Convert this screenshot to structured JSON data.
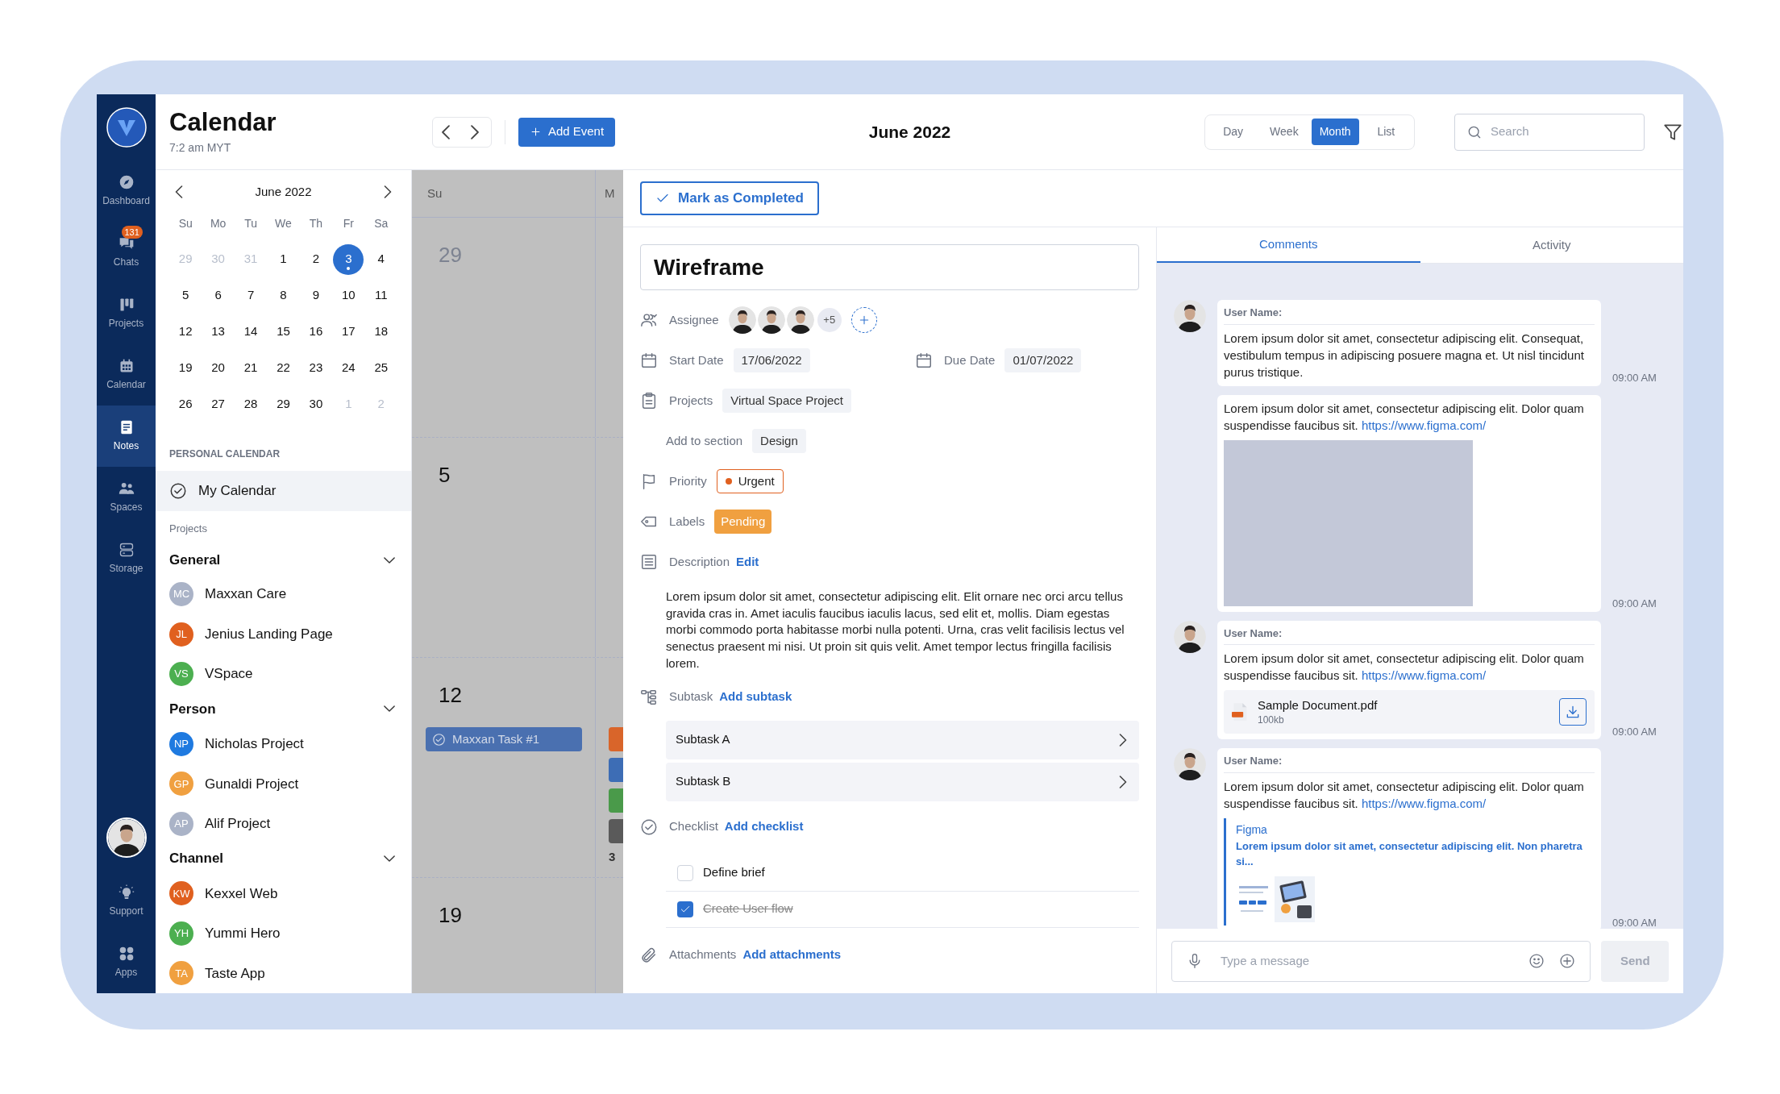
{
  "nav": {
    "items": [
      {
        "label": "Dashboard",
        "selected": false
      },
      {
        "label": "Chats",
        "badge": "131",
        "selected": false
      },
      {
        "label": "Projects",
        "selected": false
      },
      {
        "label": "Calendar",
        "selected": false
      },
      {
        "label": "Notes",
        "selected": true
      },
      {
        "label": "Spaces",
        "selected": false
      },
      {
        "label": "Storage",
        "selected": false
      }
    ],
    "bottom_items": [
      {
        "label": "Support",
        "selected": false
      },
      {
        "label": "Apps",
        "selected": false
      }
    ]
  },
  "header": {
    "title": "Calendar",
    "time": "7:2 am MYT",
    "add_event": "Add Event",
    "period": "June 2022",
    "views": [
      {
        "label": "Day",
        "selected": false
      },
      {
        "label": "Week",
        "selected": false
      },
      {
        "label": "Month",
        "selected": true
      },
      {
        "label": "List",
        "selected": false
      }
    ],
    "search": {
      "placeholder": "Search"
    }
  },
  "mini_calendar": {
    "month": "June 2022",
    "weekdays": [
      "Su",
      "Mo",
      "Tu",
      "We",
      "Th",
      "Fr",
      "Sa"
    ],
    "weeks": [
      [
        {
          "day": "29",
          "outside": true,
          "selected": false
        },
        {
          "day": "30",
          "outside": true,
          "selected": false
        },
        {
          "day": "31",
          "outside": true,
          "selected": false
        },
        {
          "day": "1",
          "outside": false,
          "selected": false
        },
        {
          "day": "2",
          "outside": false,
          "selected": false
        },
        {
          "day": "3",
          "outside": false,
          "selected": true
        },
        {
          "day": "4",
          "outside": false,
          "selected": false
        }
      ],
      [
        {
          "day": "5",
          "outside": false,
          "selected": false
        },
        {
          "day": "6",
          "outside": false,
          "selected": false
        },
        {
          "day": "7",
          "outside": false,
          "selected": false
        },
        {
          "day": "8",
          "outside": false,
          "selected": false
        },
        {
          "day": "9",
          "outside": false,
          "selected": false
        },
        {
          "day": "10",
          "outside": false,
          "selected": false
        },
        {
          "day": "11",
          "outside": false,
          "selected": false
        }
      ],
      [
        {
          "day": "12",
          "outside": false,
          "selected": false
        },
        {
          "day": "13",
          "outside": false,
          "selected": false
        },
        {
          "day": "14",
          "outside": false,
          "selected": false
        },
        {
          "day": "15",
          "outside": false,
          "selected": false
        },
        {
          "day": "16",
          "outside": false,
          "selected": false
        },
        {
          "day": "17",
          "outside": false,
          "selected": false
        },
        {
          "day": "18",
          "outside": false,
          "selected": false
        }
      ],
      [
        {
          "day": "19",
          "outside": false,
          "selected": false
        },
        {
          "day": "20",
          "outside": false,
          "selected": false
        },
        {
          "day": "21",
          "outside": false,
          "selected": false
        },
        {
          "day": "22",
          "outside": false,
          "selected": false
        },
        {
          "day": "23",
          "outside": false,
          "selected": false
        },
        {
          "day": "24",
          "outside": false,
          "selected": false
        },
        {
          "day": "25",
          "outside": false,
          "selected": false
        }
      ],
      [
        {
          "day": "26",
          "outside": false,
          "selected": false
        },
        {
          "day": "27",
          "outside": false,
          "selected": false
        },
        {
          "day": "28",
          "outside": false,
          "selected": false
        },
        {
          "day": "29",
          "outside": false,
          "selected": false
        },
        {
          "day": "30",
          "outside": false,
          "selected": false
        },
        {
          "day": "1",
          "outside": true,
          "selected": false
        },
        {
          "day": "2",
          "outside": true,
          "selected": false
        }
      ]
    ]
  },
  "personal_calendar": {
    "heading": "PERSONAL CALENDAR",
    "items": [
      {
        "label": "My Calendar",
        "selected": true
      }
    ]
  },
  "projects": {
    "heading": "Projects",
    "groups": [
      {
        "name": "General",
        "expanded": true,
        "items": [
          {
            "initials": "MC",
            "name": "Maxxan Care",
            "color": "#aab3c7"
          },
          {
            "initials": "JL",
            "name": "Jenius Landing Page",
            "color": "#e0601f"
          },
          {
            "initials": "VS",
            "name": "VSpace",
            "color": "#4caf50"
          }
        ]
      },
      {
        "name": "Person",
        "expanded": true,
        "items": [
          {
            "initials": "NP",
            "name": "Nicholas Project",
            "color": "#1f7ae0"
          },
          {
            "initials": "GP",
            "name": "Gunaldi Project",
            "color": "#f0a040"
          },
          {
            "initials": "AP",
            "name": "Alif Project",
            "color": "#aab3c7"
          }
        ]
      },
      {
        "name": "Channel",
        "expanded": true,
        "items": [
          {
            "initials": "KW",
            "name": "Kexxel Web",
            "color": "#e0601f"
          },
          {
            "initials": "YH",
            "name": "Yummi Hero",
            "color": "#4caf50"
          },
          {
            "initials": "TA",
            "name": "Taste App",
            "color": "#f0a040"
          }
        ]
      }
    ]
  },
  "month_grid": {
    "columns": [
      {
        "weekday": "Su",
        "cells": [
          {
            "day": "29",
            "outside": true
          },
          {
            "day": "5",
            "outside": false
          },
          {
            "day": "12",
            "outside": false,
            "events": [
              {
                "title": "Maxxan Task #1"
              }
            ]
          },
          {
            "day": "19",
            "outside": false
          }
        ]
      },
      {
        "weekday": "M",
        "markers": [
          {
            "color": "#d9652a"
          },
          {
            "color": "#3d6db5"
          },
          {
            "color": "#4a9a4a"
          },
          {
            "color": "#5a5a5a"
          }
        ],
        "more": "3"
      }
    ]
  },
  "task": {
    "mark_completed": "Mark as Completed",
    "title": "Wireframe",
    "assignee": {
      "label": "Assignee",
      "people": [
        {
          "kind": "avatar"
        },
        {
          "kind": "avatar"
        },
        {
          "kind": "avatar"
        }
      ],
      "more": "+5"
    },
    "start_date": {
      "label": "Start Date",
      "value": "17/06/2022"
    },
    "due_date": {
      "label": "Due Date",
      "value": "01/07/2022"
    },
    "project": {
      "label": "Projects",
      "value": "Virtual Space Project"
    },
    "section": {
      "label": "Add to section",
      "value": "Design"
    },
    "priority": {
      "label": "Priority",
      "value": "Urgent"
    },
    "labels": {
      "label": "Labels",
      "value": "Pending"
    },
    "description": {
      "label": "Description",
      "action": "Edit",
      "text": "Lorem ipsum dolor sit amet, consectetur adipiscing elit. Elit ornare nec orci arcu tellus gravida cras in. Amet iaculis faucibus iaculis lacus, sed elit et, mollis. Diam egestas morbi commodo porta habitasse morbi nulla potenti. Urna, cras velit facilisis lectus vel senectus praesent mi nisi. Ut proin sit quis velit. Amet tempor lectus fringilla facilisis lorem."
    },
    "subtask": {
      "label": "Subtask",
      "action": "Add subtask",
      "items": [
        "Subtask A",
        "Subtask B"
      ]
    },
    "checklist": {
      "label": "Checklist",
      "action": "Add checklist",
      "items": [
        {
          "text": "Define brief",
          "checked": false
        },
        {
          "text": "Create User flow",
          "checked": true
        }
      ]
    },
    "attachments": {
      "label": "Attachments",
      "action": "Add attachments"
    }
  },
  "comments": {
    "tabs": [
      {
        "label": "Comments",
        "selected": true
      },
      {
        "label": "Activity",
        "selected": false
      }
    ],
    "messages": [
      {
        "author": "User Name:",
        "text": "Lorem ipsum dolor sit amet, consectetur adipiscing elit. Consequat, vestibulum tempus in adipiscing posuere magna et. Ut nisl tincidunt purus tristique.",
        "time": "09:00 AM"
      },
      {
        "text": "Lorem ipsum dolor sit amet, consectetur adipiscing elit. Dolor quam suspendisse faucibus sit.",
        "link": "https://www.figma.com/",
        "time": "09:00 AM"
      },
      {
        "author": "User Name:",
        "text": "Lorem ipsum dolor sit amet, consectetur adipiscing elit. Dolor quam suspendisse faucibus sit.",
        "link": "https://www.figma.com/",
        "attachment": {
          "kind": "file",
          "name": "Sample Document.pdf",
          "size": "100kb"
        },
        "time": "09:00 AM"
      },
      {
        "author": "User Name:",
        "text": "Lorem ipsum dolor sit amet, consectetur adipiscing elit. Dolor quam suspendisse faucibus sit.",
        "link": "https://www.figma.com/",
        "attachment": {
          "kind": "link_preview",
          "title": "Figma",
          "description": "Lorem ipsum dolor sit amet, consectetur adipiscing elit. Non pharetra si..."
        },
        "time": "09:00 AM"
      }
    ],
    "composer": {
      "placeholder": "Type a message",
      "send": "Send",
      "disabled": true
    }
  }
}
